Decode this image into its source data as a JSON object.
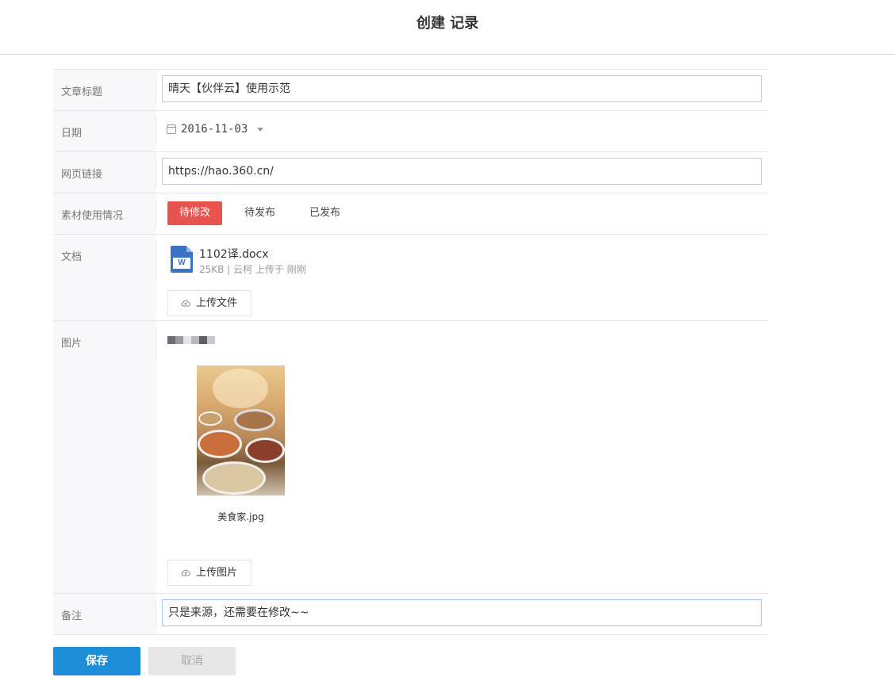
{
  "header": {
    "title": "创建 记录"
  },
  "form": {
    "title_field": {
      "label": "文章标题",
      "value": "晴天【伙伴云】使用示范"
    },
    "date_field": {
      "label": "日期",
      "value": "2016-11-03"
    },
    "link_field": {
      "label": "网页链接",
      "value": "https://hao.360.cn/"
    },
    "status_field": {
      "label": "素材使用情况",
      "options": [
        "待修改",
        "待发布",
        "已发布"
      ],
      "selected": "待修改",
      "active_color": "#e8524f"
    },
    "doc_field": {
      "label": "文档",
      "file_name": "1102译.docx",
      "file_meta": "25KB | 云柯 上传于 刚刚",
      "upload_label": "上传文件"
    },
    "image_field": {
      "label": "图片",
      "image_name": "美食家.jpg",
      "upload_label": "上传图片"
    },
    "note_field": {
      "label": "备注",
      "value": "只是来源，还需要在修改~~"
    }
  },
  "actions": {
    "save_label": "保存",
    "cancel_label": "取消",
    "save_color": "#1d8fd8"
  }
}
